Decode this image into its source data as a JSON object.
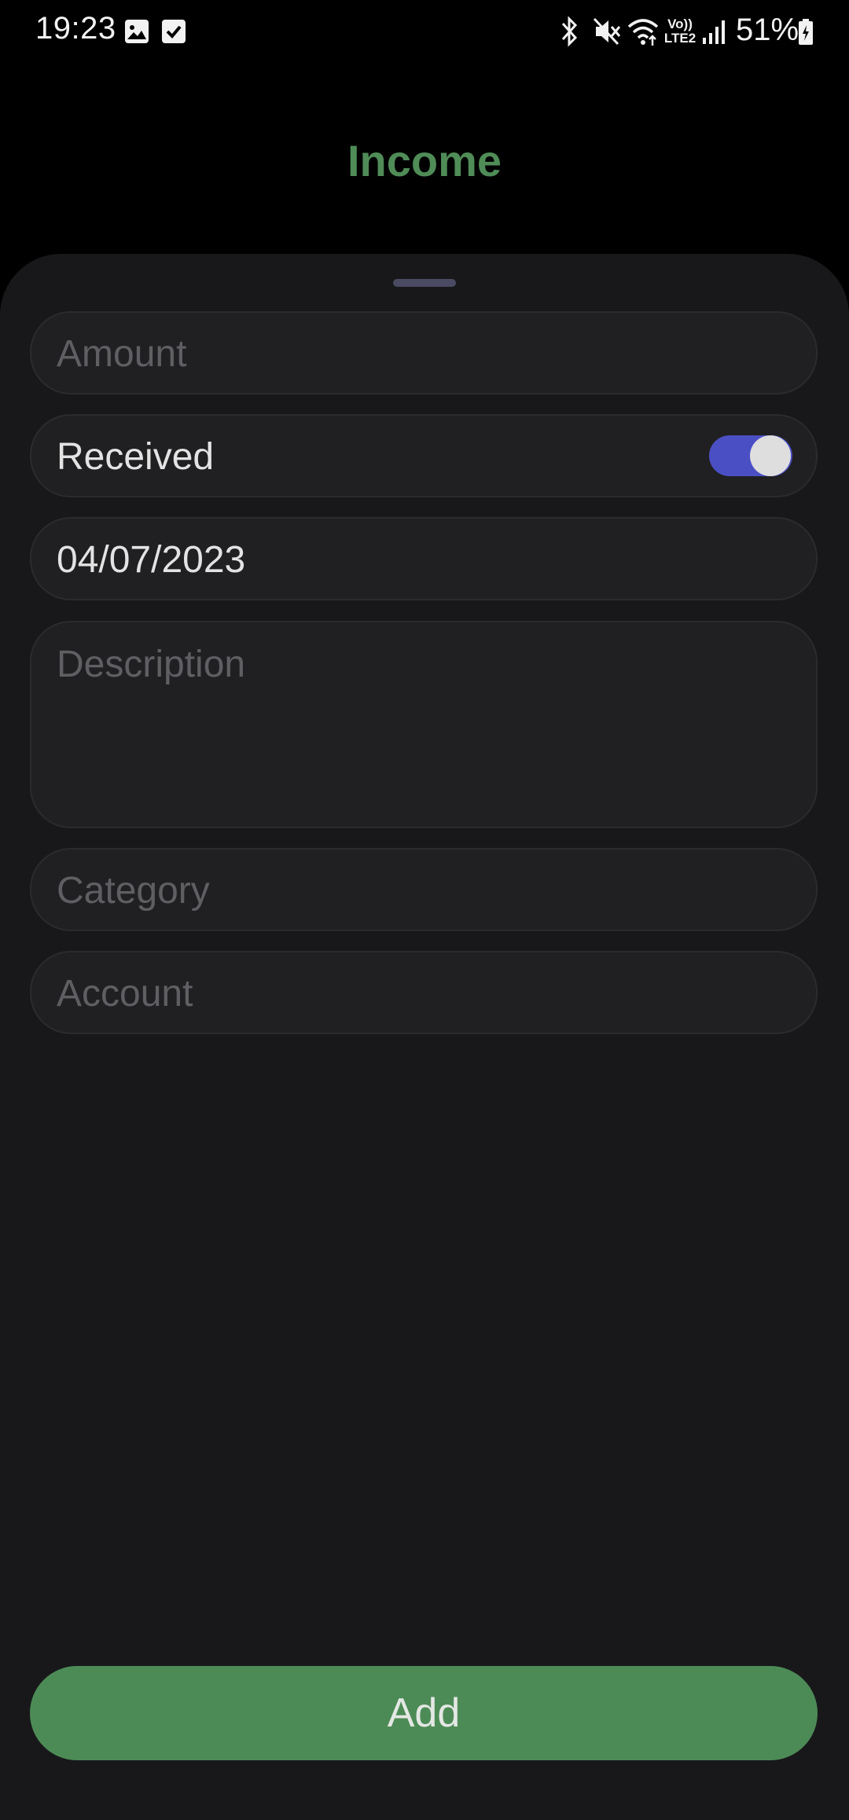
{
  "status_bar": {
    "time": "19:23",
    "battery_percent": "51%",
    "left_icons": [
      "gallery-icon",
      "checkbox-icon"
    ],
    "right_icons": [
      "bluetooth-icon",
      "mute-icon",
      "wifi-icon",
      "volte-icon",
      "signal-icon",
      "battery-charging-icon"
    ],
    "volte_line1": "Vo))",
    "volte_line2": "LTE2"
  },
  "header": {
    "title": "Income",
    "title_color": "#4f8c57"
  },
  "form": {
    "amount_placeholder": "Amount",
    "received_label": "Received",
    "received_on": true,
    "toggle_color": "#4b4fc4",
    "date_value": "04/07/2023",
    "description_placeholder": "Description",
    "category_placeholder": "Category",
    "account_placeholder": "Account"
  },
  "actions": {
    "add_label": "Add",
    "add_color": "#4d8b56"
  }
}
